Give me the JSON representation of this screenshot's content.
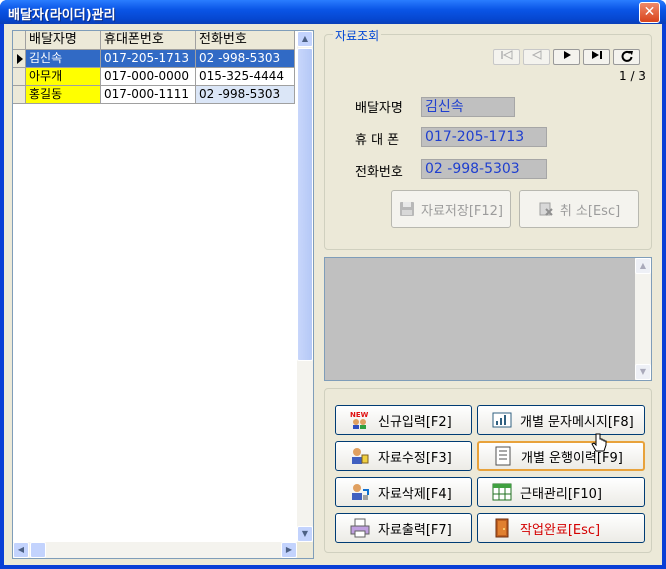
{
  "window": {
    "title": "배달자(라이더)관리",
    "close_glyph": "✕"
  },
  "grid": {
    "columns": [
      "배달자명",
      "휴대폰번호",
      "전화번호"
    ],
    "rows": [
      {
        "name": "김신속",
        "mobile": "017-205-1713",
        "phone": "02 -998-5303",
        "selected": true
      },
      {
        "name": "아무개",
        "mobile": "017-000-0000",
        "phone": "015-325-4444",
        "selected": false
      },
      {
        "name": "홍길동",
        "mobile": "017-000-1111",
        "phone": "02 -998-5303",
        "selected": false
      }
    ]
  },
  "lookup": {
    "group_title": "자료조회",
    "page_counter": "1 / 3",
    "fields": {
      "name_label": "배달자명",
      "name_value": "김신속",
      "mobile_label": "휴 대 폰",
      "mobile_value": "017-205-1713",
      "phone_label": "전화번호",
      "phone_value": "02 -998-5303"
    },
    "save_label": "자료저장[F12]",
    "cancel_label": "취 소[Esc]"
  },
  "actions": {
    "new": "신규입력[F2]",
    "sms": "개별 문자메시지[F8]",
    "edit": "자료수정[F3]",
    "history": "개별 운행이력[F9]",
    "delete": "자료삭제[F4]",
    "attendance": "근태관리[F10]",
    "print": "자료출력[F7]",
    "done": "작업완료[Esc]"
  },
  "colors": {
    "titlebar": "#0a55e6",
    "selection": "#316ac5",
    "highlight_yellow": "#ffff00",
    "field_text": "#1f3fcf",
    "done_text": "#d40000"
  }
}
